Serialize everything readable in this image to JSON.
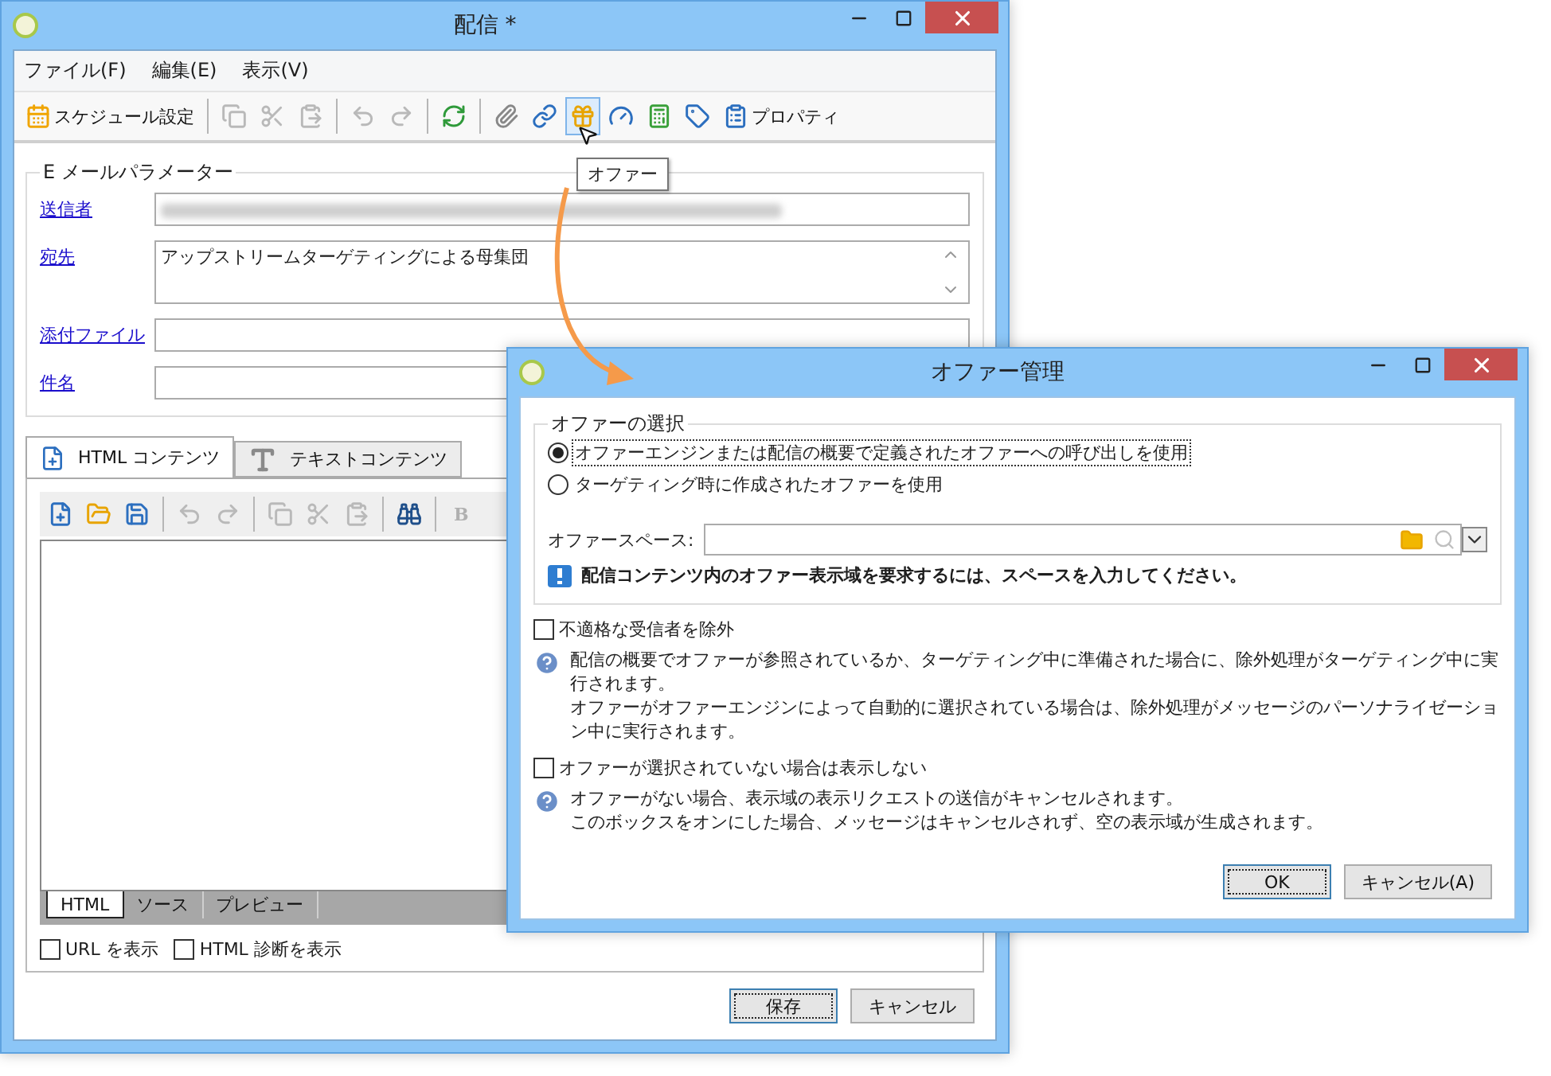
{
  "main_window": {
    "title": "配信 *",
    "menu": [
      "ファイル(F)",
      "編集(E)",
      "表示(V)"
    ],
    "toolbar": [
      [
        {
          "label": "スケジュール設定",
          "disabled": false,
          "hovered": false
        }
      ],
      [
        {
          "disabled": true,
          "hovered": false
        },
        {
          "disabled": true,
          "hovered": false
        },
        {
          "disabled": true,
          "hovered": false
        }
      ],
      [
        {
          "disabled": true,
          "hovered": false
        },
        {
          "disabled": true,
          "hovered": false
        }
      ],
      [
        {
          "disabled": false,
          "hovered": false
        }
      ],
      [
        {
          "disabled": false,
          "hovered": false
        },
        {
          "disabled": false,
          "hovered": false
        },
        {
          "disabled": false,
          "hovered": true
        },
        {
          "disabled": false,
          "hovered": false
        },
        {
          "disabled": false,
          "hovered": false
        },
        {
          "disabled": false,
          "hovered": false
        },
        {
          "label": "プロパティ",
          "disabled": false,
          "hovered": false
        }
      ]
    ],
    "tooltip": "オファー",
    "email_group": {
      "legend": "E メールパラメーター",
      "fields": [
        {
          "kind": "blurred",
          "label": "送信者"
        },
        {
          "kind": "multiline",
          "label": "宛先",
          "value": "アップストリームターゲティングによる母集団"
        },
        {
          "kind": "single",
          "label": "添付ファイル"
        },
        {
          "kind": "single",
          "label": "件名"
        }
      ]
    },
    "content_tabs": [
      {
        "label": "HTML コンテンツ",
        "selected": true
      },
      {
        "label": "テキストコンテンツ",
        "selected": false
      }
    ],
    "editor_toolbar": [
      [
        {
          "disabled": false
        },
        {
          "disabled": false
        },
        {
          "disabled": false
        }
      ],
      [
        {
          "disabled": true
        },
        {
          "disabled": true
        }
      ],
      [
        {
          "disabled": true
        },
        {
          "disabled": true
        },
        {
          "disabled": true
        }
      ],
      [
        {
          "disabled": false
        }
      ],
      [
        {
          "label": "B",
          "disabled": true
        }
      ]
    ],
    "view_tabs": [
      {
        "label": "HTML",
        "selected": true
      },
      {
        "label": "ソース",
        "selected": false
      },
      {
        "label": "プレビュー",
        "selected": false
      }
    ],
    "options": [
      {
        "label": "URL を表示",
        "checked": false
      },
      {
        "label": "HTML 診断を表示",
        "checked": false
      }
    ],
    "buttons": [
      {
        "label": "保存",
        "default": true
      },
      {
        "label": "キャンセル",
        "default": false
      }
    ]
  },
  "dialog": {
    "title": "オファー管理",
    "group": {
      "legend": "オファーの選択",
      "radios": [
        {
          "label": "オファーエンジンまたは配信の概要で定義されたオファーへの呼び出しを使用",
          "selected": true
        },
        {
          "label": "ターゲティング時に作成されたオファーを使用",
          "selected": false
        }
      ],
      "space_label": "オファースペース:",
      "warning": "配信コンテンツ内のオファー表示域を要求するには、スペースを入力してください。"
    },
    "options": [
      {
        "label": "不適格な受信者を除外",
        "checked": false,
        "help": [
          "配信の概要でオファーが参照されているか、ターゲティング中に準備された場合に、除外処理がターゲティング中に実行されます。",
          "オファーがオファーエンジンによって自動的に選択されている場合は、除外処理がメッセージのパーソナライゼーション中に実行されます。"
        ]
      },
      {
        "label": "オファーが選択されていない場合は表示しない",
        "checked": false,
        "help": [
          "オファーがない場合、表示域の表示リクエストの送信がキャンセルされます。",
          "このボックスをオンにした場合、メッセージはキャンセルされず、空の表示域が生成されます。"
        ]
      }
    ],
    "buttons": [
      {
        "label": "OK",
        "default": true
      },
      {
        "label": "キャンセル(A)",
        "default": false
      }
    ]
  }
}
